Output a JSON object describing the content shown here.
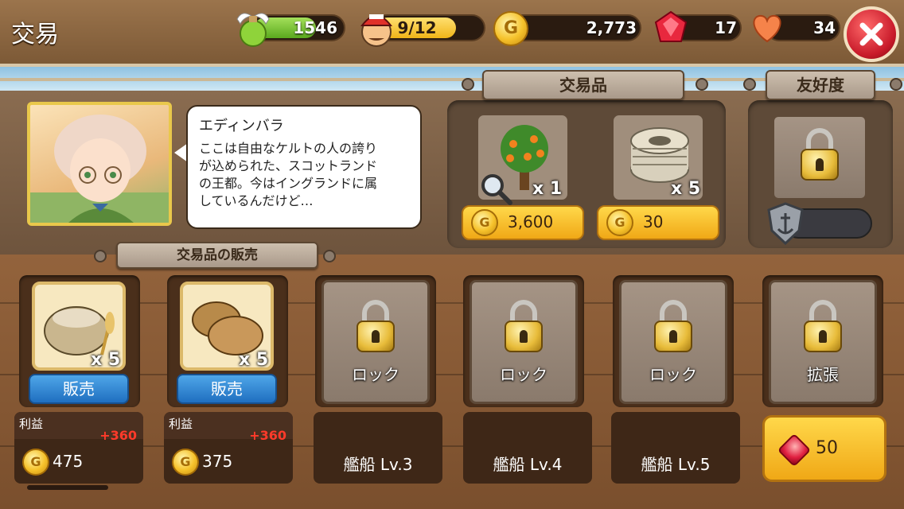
{
  "header": {
    "title": "交易",
    "stamina": {
      "value": "1546",
      "fill": 0.7
    },
    "crew": {
      "value": "9/12",
      "fill": 0.75
    },
    "gold": {
      "value": "2,773"
    },
    "gems": {
      "value": "17"
    },
    "hearts": {
      "value": "34"
    },
    "close_icon": "close-x-icon"
  },
  "city": {
    "speaker": "エディンバラ",
    "dialog": "ここは自由なケルトの人の誇り\nが込められた、スコットランド\nの王都。今はイングランドに属\nしているんだけど…"
  },
  "trade_goods": {
    "header": "交易品",
    "items": [
      {
        "icon": "orange-tree-icon",
        "qty": "x 1",
        "price": "3,600",
        "has_search": true
      },
      {
        "icon": "rope-coil-icon",
        "qty": "x 5",
        "price": "30",
        "has_search": false
      }
    ]
  },
  "friendship": {
    "header": "友好度",
    "locked": true,
    "progress": 0.0
  },
  "sales": {
    "header": "交易品の販売",
    "slots": [
      {
        "type": "item",
        "icon": "grain-sack-icon",
        "qty": "x 5",
        "sell_label": "販売",
        "profit_label": "利益",
        "profit": "+360",
        "income": "475"
      },
      {
        "type": "item",
        "icon": "potatoes-icon",
        "qty": "x 5",
        "sell_label": "販売",
        "profit_label": "利益",
        "profit": "+360",
        "income": "375"
      },
      {
        "type": "locked",
        "label": "ロック",
        "requirement": "艦船 Lv.3"
      },
      {
        "type": "locked",
        "label": "ロック",
        "requirement": "艦船 Lv.4"
      },
      {
        "type": "locked",
        "label": "ロック",
        "requirement": "艦船 Lv.5"
      },
      {
        "type": "expand",
        "label": "拡張",
        "price": "50"
      }
    ]
  },
  "colors": {
    "gold_button": "#f0a816",
    "sell_button": "#1f6fc0",
    "profit_plus": "#ff3a2a"
  }
}
